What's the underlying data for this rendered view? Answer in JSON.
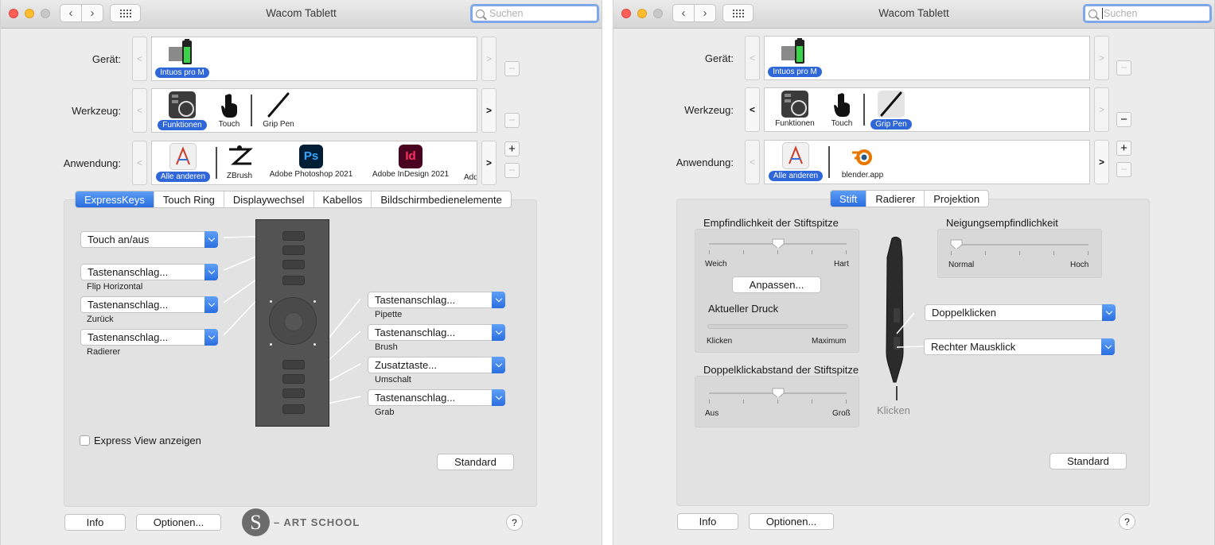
{
  "left": {
    "title": "Wacom Tablett",
    "search_placeholder": "Suchen",
    "device_label": "Gerät:",
    "device_name": "Intuos pro M",
    "tool_label": "Werkzeug:",
    "tools": [
      "Funktionen",
      "Touch",
      "Grip Pen"
    ],
    "app_label": "Anwendung:",
    "apps": [
      "Alle anderen",
      "ZBrush",
      "Adobe Photoshop 2021",
      "Adobe InDesign 2021",
      "Add"
    ],
    "tabs": [
      "ExpressKeys",
      "Touch Ring",
      "Displaywechsel",
      "Kabellos",
      "Bildschirmbedienelemente"
    ],
    "left_dropdowns": [
      {
        "value": "Touch an/aus",
        "sub": ""
      },
      {
        "value": "Tastenanschlag...",
        "sub": "Flip Horizontal"
      },
      {
        "value": "Tastenanschlag...",
        "sub": "Zurück"
      },
      {
        "value": "Tastenanschlag...",
        "sub": "Radierer"
      }
    ],
    "right_dropdowns": [
      {
        "value": "Tastenanschlag...",
        "sub": "Pipette"
      },
      {
        "value": "Tastenanschlag...",
        "sub": "Brush"
      },
      {
        "value": "Zusatztaste...",
        "sub": "Umschalt"
      },
      {
        "value": "Tastenanschlag...",
        "sub": "Grab"
      }
    ],
    "express_view": "Express View anzeigen",
    "standard": "Standard",
    "info": "Info",
    "options": "Optionen...",
    "help": "?",
    "watermark": "– ART SCHOOL",
    "watermark_letter": "S"
  },
  "right": {
    "title": "Wacom Tablett",
    "search_placeholder": "Suchen",
    "device_label": "Gerät:",
    "device_name": "Intuos pro M",
    "tool_label": "Werkzeug:",
    "tools": [
      "Funktionen",
      "Touch",
      "Grip Pen"
    ],
    "app_label": "Anwendung:",
    "apps": [
      "Alle anderen",
      "blender.app"
    ],
    "tabs": [
      "Stift",
      "Radierer",
      "Projektion"
    ],
    "tip_sensitivity": "Empfindlichkeit der Stiftspitze",
    "soft": "Weich",
    "firm": "Hart",
    "customize": "Anpassen...",
    "current_pressure": "Aktueller Druck",
    "click": "Klicken",
    "maximum": "Maximum",
    "dblclick_distance": "Doppelklickabstand der Stiftspitze",
    "off": "Aus",
    "large": "Groß",
    "tilt": "Neigungsempfindlichkeit",
    "normal": "Normal",
    "high": "Hoch",
    "upper_button": "Doppelklicken",
    "lower_button": "Rechter Mausklick",
    "tip_label": "Klicken",
    "standard": "Standard",
    "info": "Info",
    "options": "Optionen...",
    "help": "?"
  },
  "colors": {
    "accent": "#2f66d8",
    "panel": "#e2e2e2",
    "window": "#ececec"
  }
}
